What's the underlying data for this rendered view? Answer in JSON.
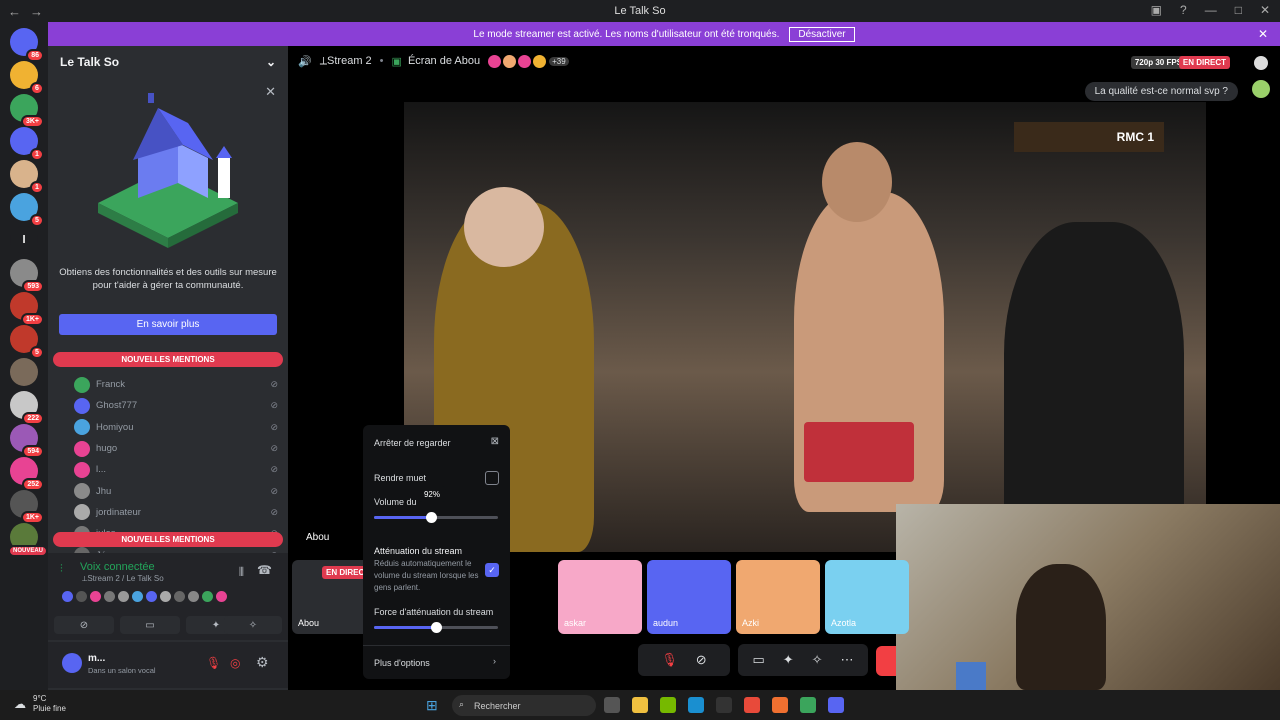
{
  "window": {
    "title": "Le Talk So",
    "back": "←",
    "forward": "→"
  },
  "banner": {
    "text": "Le mode streamer est activé. Les noms d'utilisateur ont été tronqués.",
    "button": "Désactiver"
  },
  "servers": [
    {
      "color": "#5865f2",
      "badge": "86"
    },
    {
      "color": "#f0b232",
      "badge": "6"
    },
    {
      "color": "#3ba55c",
      "badge": "3K+"
    },
    {
      "color": "#5865f2",
      "badge": "1"
    },
    {
      "color": "#d9b38c",
      "badge": "1"
    },
    {
      "color": "#4aa3df",
      "badge": "5"
    },
    {
      "color": "#1e1f22",
      "label": "l"
    },
    {
      "color": "#8a8a8a",
      "badge": "593"
    },
    {
      "color": "#c0392b",
      "badge": "1K+"
    },
    {
      "color": "#c0392b",
      "badge": "5"
    },
    {
      "color": "#7a6a5a",
      "badge": ""
    },
    {
      "color": "#c8c8c8",
      "badge": "222"
    },
    {
      "color": "#9b59b6",
      "badge": "594"
    },
    {
      "color": "#e84393",
      "badge": "252"
    },
    {
      "color": "#555555",
      "badge": "1K+"
    },
    {
      "color": "#5a7a3a",
      "badge": "NOUVEAU"
    }
  ],
  "guild": {
    "name": "Le Talk So"
  },
  "promo": {
    "text": "Obtiens des fonctionnalités et des outils sur mesure pour t'aider à gérer ta communauté.",
    "button": "En savoir plus"
  },
  "mentions_label": "NOUVELLES MENTIONS",
  "members": [
    {
      "name": "Franck",
      "color": "#3ba55c"
    },
    {
      "name": "Ghost777",
      "color": "#5865f2"
    },
    {
      "name": "Homiyou",
      "color": "#4aa3df"
    },
    {
      "name": "hugo",
      "color": "#e84393"
    },
    {
      "name": "l...",
      "color": "#e84393"
    },
    {
      "name": "Jhu",
      "color": "#8a8a8a"
    },
    {
      "name": "jordinateur",
      "color": "#aaaaaa"
    },
    {
      "name": "jules",
      "color": "#777777"
    },
    {
      "name": "Jéo",
      "color": "#666666"
    }
  ],
  "voice": {
    "status": "Voix connectée",
    "channel": "⟂Stream 2 / Le Talk So"
  },
  "user": {
    "name": "m...",
    "status": "Dans un salon vocal"
  },
  "stream_header": {
    "channel": "⟂Stream 2",
    "screen": "Écran de Abou",
    "extra": "+39",
    "quality": "720p 30 FPS",
    "live": "EN DIRECT"
  },
  "chat_bubble": "La qualité est-ce normal svp ?",
  "tiles_label": "Abou",
  "tiles": [
    {
      "label": "Abou",
      "live": "EN DIRECT",
      "color": "#2b2d31"
    },
    {
      "label": "askar",
      "color": "#f7a8c8"
    },
    {
      "label": "audun",
      "color": "#5865f2"
    },
    {
      "label": "Azki",
      "color": "#f0a870"
    },
    {
      "label": "Azotla",
      "color": "#7ad0f0"
    }
  ],
  "menu": {
    "stop": "Arrêter de regarder",
    "mute": "Rendre muet",
    "volume": "Volume du",
    "volume_value": "92%",
    "volume_level": 0.46,
    "attenuation": "Atténuation du stream",
    "attenuation_desc": "Réduis automatiquement le volume du stream lorsque les gens parlent.",
    "force": "Force d'atténuation du stream",
    "force_level": 0.5,
    "more": "Plus d'options"
  },
  "taskbar": {
    "temp": "9°C",
    "weather": "Pluie fine",
    "search": "Rechercher"
  }
}
